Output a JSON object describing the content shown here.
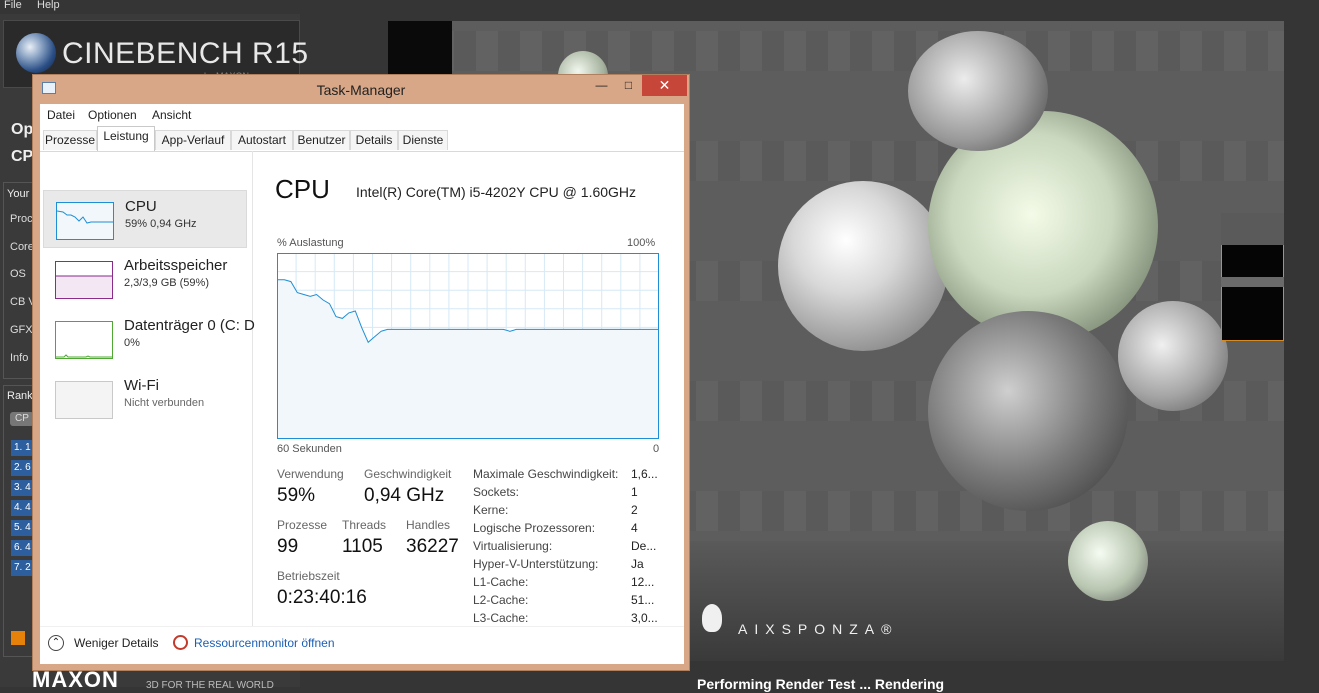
{
  "cinebench": {
    "menu": [
      "File",
      "Help"
    ],
    "logo_text": "CINEBENCH R15",
    "logo_sub": "by MAXON",
    "heading1": "Op",
    "heading2": "CP",
    "your_system_label": "Your",
    "system_rows": [
      "Proc",
      "Core",
      "OS",
      "CB V",
      "GFX",
      "Info"
    ],
    "ranking_label": "Rank",
    "ranking_chip": "CP",
    "ranks": [
      "1. 1",
      "2. 6",
      "3. 4",
      "4. 4",
      "5. 4",
      "6. 4",
      "7. 2"
    ],
    "brand": "MAXON",
    "tagline": "3D FOR THE REAL WORLD",
    "status_text": "Performing Render Test ... Rendering",
    "render_logo": "AIXSPONZA®"
  },
  "taskmanager": {
    "title": "Task-Manager",
    "menu": [
      "Datei",
      "Optionen",
      "Ansicht"
    ],
    "tabs": [
      "Prozesse",
      "Leistung",
      "App-Verlauf",
      "Autostart",
      "Benutzer",
      "Details",
      "Dienste"
    ],
    "active_tab": "Leistung",
    "resources": [
      {
        "name": "CPU",
        "detail": "59% 0,94 GHz",
        "color": "#1d8fd6"
      },
      {
        "name": "Arbeitsspeicher",
        "detail": "2,3/3,9 GB (59%)",
        "color": "#8b2a8b"
      },
      {
        "name": "Datenträger 0 (C: D",
        "detail": "0%",
        "color": "#4fa832"
      },
      {
        "name": "Wi-Fi",
        "detail": "Nicht verbunden",
        "color": "#a6a6a6"
      }
    ],
    "cpu": {
      "title": "CPU",
      "model": "Intel(R) Core(TM) i5-4202Y CPU @ 1.60GHz",
      "graph_label_top_left": "% Auslastung",
      "graph_label_top_right": "100%",
      "graph_label_bottom_left": "60 Sekunden",
      "graph_label_bottom_right": "0",
      "utilization_series": [
        86,
        86,
        85,
        79,
        78,
        77,
        78,
        75,
        73,
        66,
        65,
        68,
        69,
        60,
        52,
        55,
        58,
        59,
        59,
        59,
        59,
        59,
        59,
        59,
        59,
        59,
        59,
        59,
        59,
        59,
        59,
        59,
        59,
        59,
        59,
        59,
        58,
        59,
        59,
        59,
        59,
        59,
        59,
        59,
        59,
        59,
        59,
        59,
        59,
        59,
        59,
        59,
        59,
        59,
        59,
        59,
        59,
        59,
        59,
        59
      ],
      "stats": {
        "verwendung_label": "Verwendung",
        "verwendung_value": "59%",
        "geschwindigkeit_label": "Geschwindigkeit",
        "geschwindigkeit_value": "0,94 GHz",
        "prozesse_label": "Prozesse",
        "prozesse_value": "99",
        "threads_label": "Threads",
        "threads_value": "1105",
        "handles_label": "Handles",
        "handles_value": "36227",
        "betriebszeit_label": "Betriebszeit",
        "betriebszeit_value": "0:23:40:16"
      },
      "details": [
        {
          "label": "Maximale Geschwindigkeit:",
          "value": "1,6..."
        },
        {
          "label": "Sockets:",
          "value": "1"
        },
        {
          "label": "Kerne:",
          "value": "2"
        },
        {
          "label": "Logische Prozessoren:",
          "value": "4"
        },
        {
          "label": "Virtualisierung:",
          "value": "De..."
        },
        {
          "label": "Hyper-V-Unterstützung:",
          "value": "Ja"
        },
        {
          "label": "L1-Cache:",
          "value": "12..."
        },
        {
          "label": "L2-Cache:",
          "value": "51..."
        },
        {
          "label": "L3-Cache:",
          "value": "3,0..."
        }
      ]
    },
    "footer": {
      "fewer_details": "Weniger Details",
      "resource_monitor": "Ressourcenmonitor öffnen"
    }
  }
}
